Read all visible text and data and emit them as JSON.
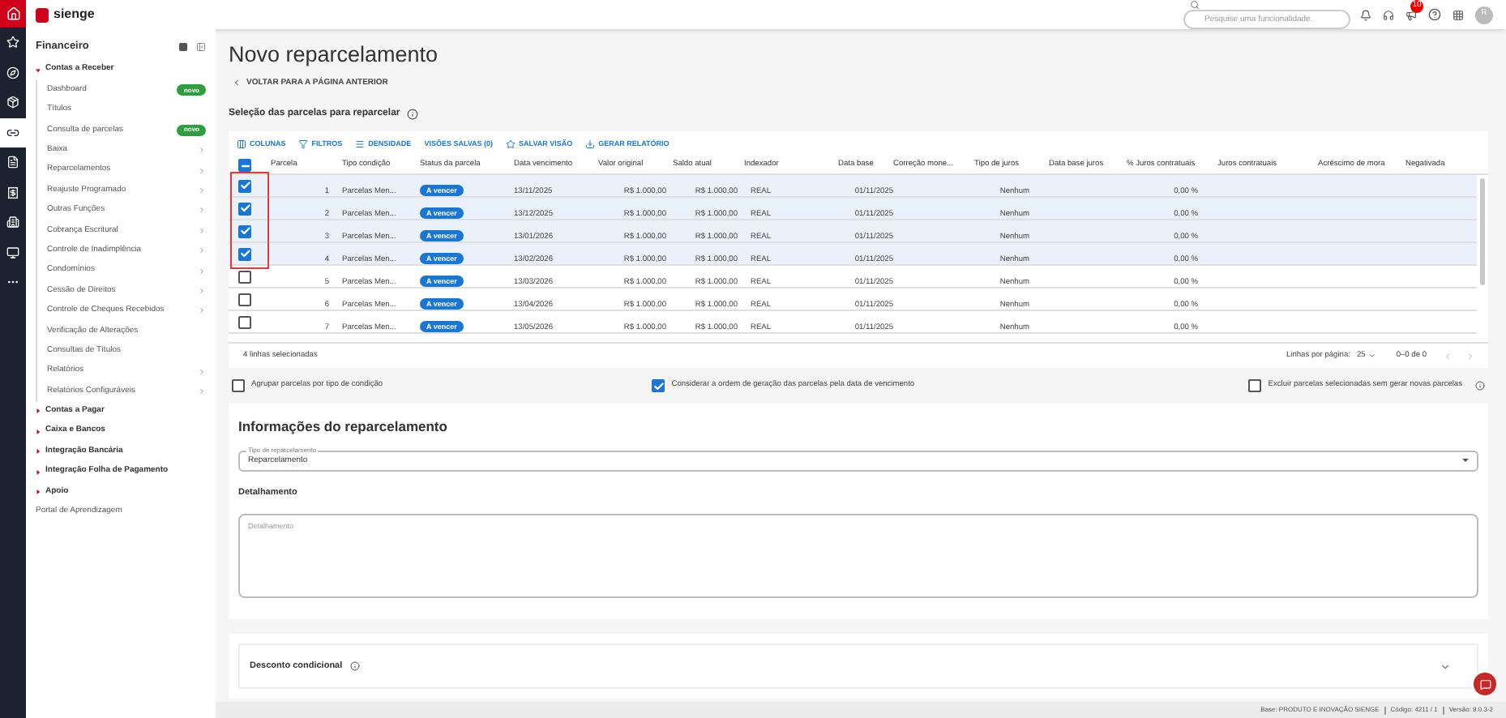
{
  "rail": [
    {
      "selected": false
    },
    {
      "selected": false
    },
    {
      "selected": false
    },
    {
      "selected": true
    },
    {
      "selected": false
    },
    {
      "selected": false
    },
    {
      "selected": false
    },
    {
      "selected": false
    },
    {
      "selected": false
    }
  ],
  "header": {
    "brand": "sienge",
    "search_placeholder": "Pesquise uma funcionalidade.",
    "notification_count": "10",
    "avatar": "R"
  },
  "sidebar": {
    "title": "Financeiro",
    "sections": [
      {
        "label": "Contas a Receber",
        "expanded": true,
        "children": [
          {
            "label": "Dashboard",
            "submenu": false,
            "badge": "novo"
          },
          {
            "label": "Títulos",
            "submenu": false
          },
          {
            "label": "Consulta de parcelas",
            "submenu": false,
            "badge": "novo"
          },
          {
            "label": "Baixa",
            "submenu": true
          },
          {
            "label": "Reparcelamentos",
            "submenu": true
          },
          {
            "label": "Reajuste Programado",
            "submenu": true
          },
          {
            "label": "Outras Funções",
            "submenu": true
          },
          {
            "label": "Cobrança Escritural",
            "submenu": true
          },
          {
            "label": "Controle de Inadimplência",
            "submenu": true
          },
          {
            "label": "Condomínios",
            "submenu": true
          },
          {
            "label": "Cessão de Direitos",
            "submenu": true
          },
          {
            "label": "Controle de Cheques Recebidos",
            "submenu": true
          },
          {
            "label": "Verificação de Alterações",
            "submenu": false
          },
          {
            "label": "Consultas de Títulos",
            "submenu": false
          },
          {
            "label": "Relatórios",
            "submenu": true
          },
          {
            "label": "Relatórios Configuráveis",
            "submenu": true
          }
        ]
      },
      {
        "label": "Contas a Pagar",
        "expanded": false
      },
      {
        "label": "Caixa e Bancos",
        "expanded": false
      },
      {
        "label": "Integração Bancária",
        "expanded": false
      },
      {
        "label": "Integração Folha de Pagamento",
        "expanded": false
      },
      {
        "label": "Apoio",
        "expanded": false
      }
    ],
    "footer_link": "Portal de Aprendizagem"
  },
  "page": {
    "title": "Novo reparcelamento",
    "back_link": "VOLTAR PARA A PÁGINA ANTERIOR",
    "section_label": "Seleção das parcelas para reparcelar"
  },
  "table": {
    "toolbar": [
      "COLUNAS",
      "FILTROS",
      "DENSIDADE",
      "VISÕES SALVAS (0)",
      "SALVAR VISÃO",
      "GERAR RELATÓRIO"
    ],
    "indeterminate": true,
    "columns": [
      "Parcela",
      "Tipo condição",
      "Status da parcela",
      "Data vencimento",
      "Valor original",
      "Saldo atual",
      "Indexador",
      "Data base",
      "Correção mone...",
      "Tipo de juros",
      "Data base juros",
      "% Juros contratuais",
      "Juros contratuais",
      "Acréscimo de mora",
      "Negativada"
    ],
    "rows": [
      {
        "selected": true,
        "parcela": "1",
        "tipo": "Parcelas Men...",
        "status": "A vencer",
        "vencimento": "13/11/2025",
        "valor": "R$ 1.000,00",
        "saldo": "R$ 1.000,00",
        "indexador": "REAL",
        "data_base": "01/11/2025",
        "tipo_juros": "Nenhum",
        "juros_pct": "0,00 %"
      },
      {
        "selected": true,
        "parcela": "2",
        "tipo": "Parcelas Men...",
        "status": "A vencer",
        "vencimento": "13/12/2025",
        "valor": "R$ 1.000,00",
        "saldo": "R$ 1.000,00",
        "indexador": "REAL",
        "data_base": "01/11/2025",
        "tipo_juros": "Nenhum",
        "juros_pct": "0,00 %"
      },
      {
        "selected": true,
        "parcela": "3",
        "tipo": "Parcelas Men...",
        "status": "A vencer",
        "vencimento": "13/01/2026",
        "valor": "R$ 1.000,00",
        "saldo": "R$ 1.000,00",
        "indexador": "REAL",
        "data_base": "01/11/2025",
        "tipo_juros": "Nenhum",
        "juros_pct": "0,00 %"
      },
      {
        "selected": true,
        "parcela": "4",
        "tipo": "Parcelas Men...",
        "status": "A vencer",
        "vencimento": "13/02/2026",
        "valor": "R$ 1.000,00",
        "saldo": "R$ 1.000,00",
        "indexador": "REAL",
        "data_base": "01/11/2025",
        "tipo_juros": "Nenhum",
        "juros_pct": "0,00 %"
      },
      {
        "selected": false,
        "parcela": "5",
        "tipo": "Parcelas Men...",
        "status": "A vencer",
        "vencimento": "13/03/2026",
        "valor": "R$ 1.000,00",
        "saldo": "R$ 1.000,00",
        "indexador": "REAL",
        "data_base": "01/11/2025",
        "tipo_juros": "Nenhum",
        "juros_pct": "0,00 %"
      },
      {
        "selected": false,
        "parcela": "6",
        "tipo": "Parcelas Men...",
        "status": "A vencer",
        "vencimento": "13/04/2026",
        "valor": "R$ 1.000,00",
        "saldo": "R$ 1.000,00",
        "indexador": "REAL",
        "data_base": "01/11/2025",
        "tipo_juros": "Nenhum",
        "juros_pct": "0,00 %"
      },
      {
        "selected": false,
        "parcela": "7",
        "tipo": "Parcelas Men...",
        "status": "A vencer",
        "vencimento": "13/05/2026",
        "valor": "R$ 1.000,00",
        "saldo": "R$ 1.000,00",
        "indexador": "REAL",
        "data_base": "01/11/2025",
        "tipo_juros": "Nenhum",
        "juros_pct": "0,00 %"
      }
    ],
    "selection_count": "4 linhas selecionadas",
    "rows_per_page_label": "Linhas por página:",
    "rows_per_page": "25",
    "range": "0–0 de 0"
  },
  "options": [
    {
      "label": "Agrupar parcelas por tipo de condição",
      "checked": false,
      "info": false
    },
    {
      "label": "Considerar a ordem de geração das parcelas pela data de vencimento",
      "checked": true,
      "info": false
    },
    {
      "label": "Excluir parcelas selecionadas sem gerar novas parcelas",
      "checked": false,
      "info": true
    }
  ],
  "info": {
    "title": "Informações do reparcelamento",
    "select_label": "Tipo de reparcelamento",
    "select_value": "Reparcelamento",
    "detail_heading": "Detalhamento",
    "detail_placeholder": "Detalhamento"
  },
  "discount": {
    "title": "Desconto condicional",
    "expanded": false
  },
  "status_bar": [
    "Base: PRODUTO E INOVAÇÃO SIENGE",
    "Código: 4211 / 1",
    "Versão: 9.0.3-2"
  ]
}
